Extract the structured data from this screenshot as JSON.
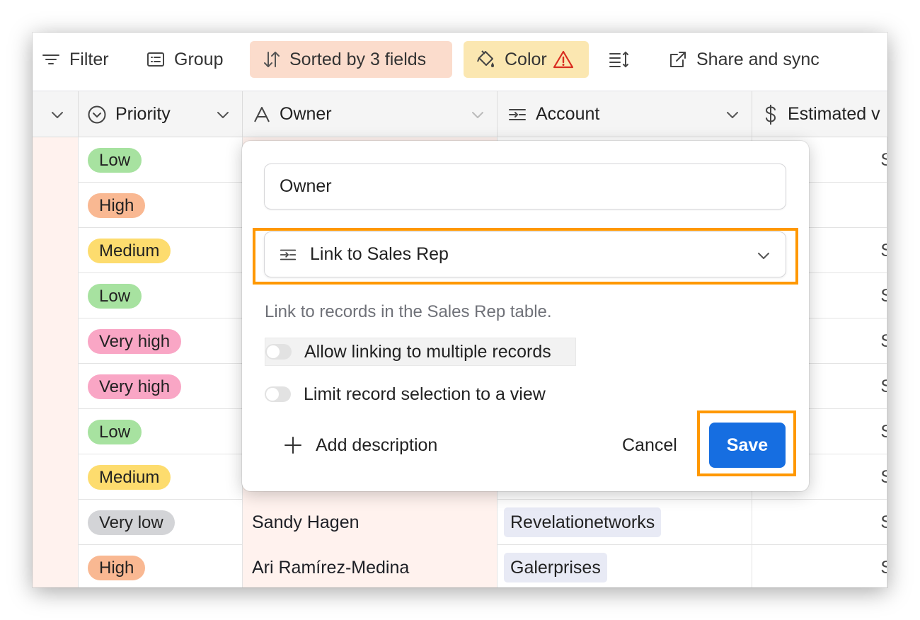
{
  "toolbar": {
    "filter_label": "Filter",
    "group_label": "Group",
    "sort_label": "Sorted by 3 fields",
    "color_label": "Color"
  },
  "share_label": "Share and sync",
  "colors": {
    "sort_bg": "#fbdccc",
    "color_bg": "#fbe7b1",
    "accent": "#166ee1",
    "highlight": "#ff9800",
    "warning": "#d92d20"
  },
  "columns": {
    "priority": "Priority",
    "owner": "Owner",
    "account": "Account",
    "estimated": "Estimated v"
  },
  "rows": [
    {
      "priority": "Low",
      "priority_color": "#a7e2a0",
      "owner": "",
      "account": "",
      "trail": "S"
    },
    {
      "priority": "High",
      "priority_color": "#f9b892",
      "owner": "",
      "account": "",
      "trail": ""
    },
    {
      "priority": "Medium",
      "priority_color": "#fddc6e",
      "owner": "",
      "account": "",
      "trail": "S"
    },
    {
      "priority": "Low",
      "priority_color": "#a7e2a0",
      "owner": "",
      "account": "",
      "trail": "S"
    },
    {
      "priority": "Very high",
      "priority_color": "#f9a6c5",
      "owner": "",
      "account": "",
      "trail": "S"
    },
    {
      "priority": "Very high",
      "priority_color": "#f9a6c5",
      "owner": "",
      "account": "",
      "trail": "S"
    },
    {
      "priority": "Low",
      "priority_color": "#a7e2a0",
      "owner": "",
      "account": "",
      "trail": "S"
    },
    {
      "priority": "Medium",
      "priority_color": "#fddc6e",
      "owner": "",
      "account": "",
      "trail": "S"
    },
    {
      "priority": "Very low",
      "priority_color": "#d3d4d7",
      "owner": "Sandy Hagen",
      "account": "Revelationetworks",
      "trail": "S"
    },
    {
      "priority": "High",
      "priority_color": "#f9b892",
      "owner": "Ari Ramírez-Medina",
      "account": "Galerprises",
      "trail": "S"
    }
  ],
  "dialog": {
    "field_name": "Owner",
    "field_type": "Link to Sales Rep",
    "hint": "Link to records in the Sales Rep table.",
    "allow_multiple_label": "Allow linking to multiple records",
    "allow_multiple_on": false,
    "limit_view_label": "Limit record selection to a view",
    "limit_view_on": false,
    "add_description_label": "Add description",
    "cancel_label": "Cancel",
    "save_label": "Save"
  },
  "icons": {
    "filter": "filter-icon",
    "group": "group-icon",
    "sort": "sort-icon",
    "color": "paint-bucket-icon",
    "warning": "warning-icon",
    "row_height": "row-height-icon",
    "share": "share-icon",
    "priority": "single-select-icon",
    "owner": "text-field-icon",
    "account": "link-field-icon",
    "estimated": "currency-icon"
  }
}
